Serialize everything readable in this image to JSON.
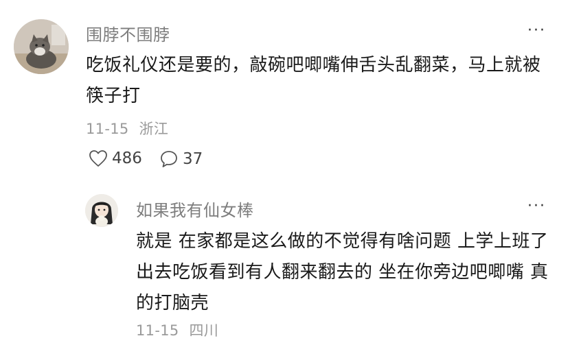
{
  "comment": {
    "username": "围脖不围脖",
    "text": "吃饭礼仪还是要的，敲碗吧唧嘴伸舌头乱翻菜，马上就被筷子打",
    "date": "11-15",
    "location": "浙江",
    "likes": "486",
    "replies": "37",
    "more": "···"
  },
  "reply": {
    "username": "如果我有仙女棒",
    "text": "就是 在家都是这么做的不觉得有啥问题 上学上班了出去吃饭看到有人翻来翻去的 坐在你旁边吧唧嘴 真的打脑壳",
    "date": "11-15",
    "location": "四川",
    "more": "···"
  },
  "icons": {
    "like": "heart-outline-icon",
    "reply": "speech-bubble-icon",
    "more": "more-dots-icon"
  }
}
